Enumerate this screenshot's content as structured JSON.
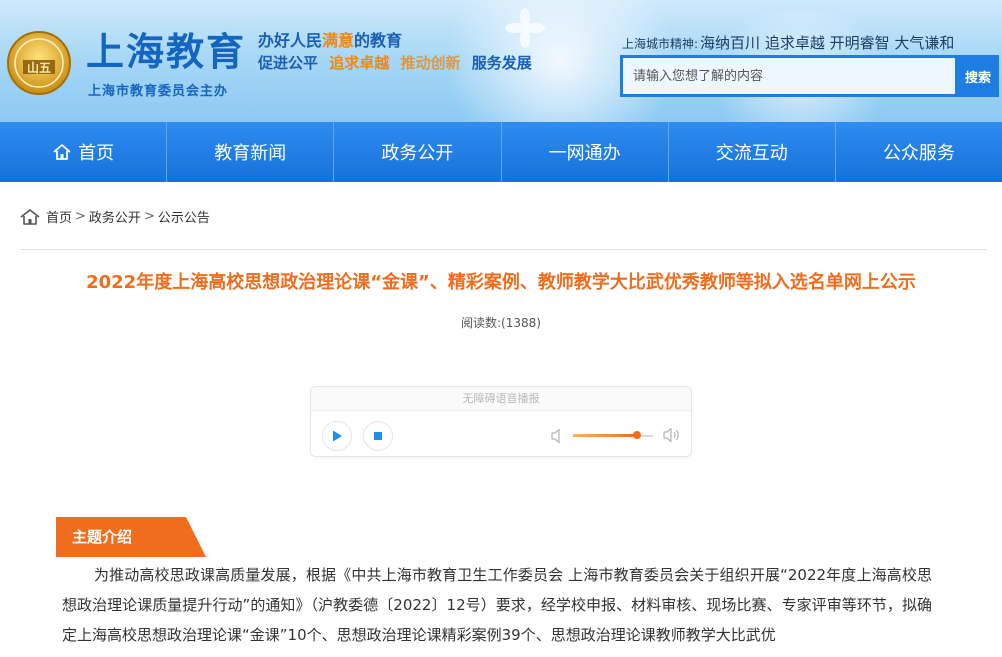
{
  "header": {
    "logo_emblem_text": "山五",
    "logo_title": "上海教育",
    "logo_subtitle": "上海市教育委员会主办",
    "slogan_line1_part1": "办好人民",
    "slogan_line1_highlight": "满意",
    "slogan_line1_part2": "的教育",
    "slogan_line2": [
      "促进公平",
      "追求卓越",
      "推动创新",
      "服务发展"
    ],
    "spirit_label": "上海城市精神:",
    "spirit_words": "海纳百川 追求卓越 开明睿智 大气谦和",
    "search_placeholder": "请输入您想了解的内容",
    "search_button": "搜索"
  },
  "nav": {
    "items": [
      "首页",
      "教育新闻",
      "政务公开",
      "一网通办",
      "交流互动",
      "公众服务"
    ]
  },
  "breadcrumb": {
    "home": "首页",
    "items": [
      "政务公开",
      "公示公告"
    ],
    "separator": ">"
  },
  "article": {
    "title": "2022年度上海高校思想政治理论课“金课”、精彩案例、教师教学大比武优秀教师等拟入选名单网上公示",
    "read_count": "阅读数:(1388)",
    "section_label": "主题介绍",
    "body": "为推动高校思政课高质量发展，根据《中共上海市教育卫生工作委员会 上海市教育委员会关于组织开展“2022年度上海高校思想政治理论课质量提升行动”的通知》（沪教委德〔2022〕12号）要求，经学校申报、材料审核、现场比赛、专家评审等环节，拟确定上海高校思想政治理论课“金课”10个、思想政治理论课精彩案例39个、思想政治理论课教师教学大比武优"
  },
  "player": {
    "title": "无障碍语音播报",
    "volume": 0.8
  },
  "colors": {
    "brand_blue": "#1670da",
    "accent_orange": "#f06d1e",
    "logo_gold": "#d4a017"
  }
}
